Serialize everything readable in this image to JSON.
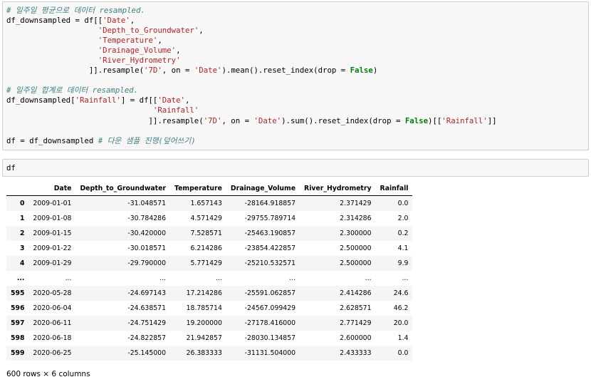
{
  "cell1": {
    "line1_comment": "# 일주일 평균으로 데이터 resampled.",
    "line2_pre": "df_downsampled = df[[",
    "line2_str": "'Date'",
    "line2_post": ",",
    "line3_indent": "                    ",
    "line3_str": "'Depth_to_Groundwater'",
    "line3_post": ",",
    "line4_indent": "                    ",
    "line4_str": "'Temperature'",
    "line4_post": ",",
    "line5_indent": "                    ",
    "line5_str": "'Drainage_Volume'",
    "line5_post": ",",
    "line6_indent": "                    ",
    "line6_str": "'River_Hydrometry'",
    "line7_pre": "                  ]].resample(",
    "line7_str1": "'7D'",
    "line7_mid1": ", on = ",
    "line7_str2": "'Date'",
    "line7_mid2": ").mean().reset_index(drop = ",
    "line7_kw": "False",
    "line7_post": ")",
    "line9_comment": "# 일주일 합계로 데이터 resampled.",
    "line10_pre": "df_downsampled[",
    "line10_str1": "'Rainfall'",
    "line10_mid": "] = df[[",
    "line10_str2": "'Date'",
    "line10_post": ",",
    "line11_indent": "                                ",
    "line11_str": "'Rainfall'",
    "line12_pre": "                               ]].resample(",
    "line12_str1": "'7D'",
    "line12_mid1": ", on = ",
    "line12_str2": "'Date'",
    "line12_mid2": ").sum().reset_index(drop = ",
    "line12_kw": "False",
    "line12_mid3": ")[[",
    "line12_str3": "'Rainfall'",
    "line12_post": "]]",
    "line14_code": "df = df_downsampled ",
    "line14_comment": "# 다운 샘플 진행(덮어쓰기)"
  },
  "cell2": {
    "code": "df"
  },
  "table": {
    "columns": [
      "",
      "Date",
      "Depth_to_Groundwater",
      "Temperature",
      "Drainage_Volume",
      "River_Hydrometry",
      "Rainfall"
    ],
    "rows": [
      [
        "0",
        "2009-01-01",
        "-31.048571",
        "1.657143",
        "-28164.918857",
        "2.371429",
        "0.0"
      ],
      [
        "1",
        "2009-01-08",
        "-30.784286",
        "4.571429",
        "-29755.789714",
        "2.314286",
        "2.0"
      ],
      [
        "2",
        "2009-01-15",
        "-30.420000",
        "7.528571",
        "-25463.190857",
        "2.300000",
        "0.2"
      ],
      [
        "3",
        "2009-01-22",
        "-30.018571",
        "6.214286",
        "-23854.422857",
        "2.500000",
        "4.1"
      ],
      [
        "4",
        "2009-01-29",
        "-29.790000",
        "5.771429",
        "-25210.532571",
        "2.500000",
        "9.9"
      ],
      [
        "...",
        "...",
        "...",
        "...",
        "...",
        "...",
        "..."
      ],
      [
        "595",
        "2020-05-28",
        "-24.697143",
        "17.214286",
        "-25591.062857",
        "2.414286",
        "24.6"
      ],
      [
        "596",
        "2020-06-04",
        "-24.638571",
        "18.785714",
        "-24567.099429",
        "2.628571",
        "46.2"
      ],
      [
        "597",
        "2020-06-11",
        "-24.751429",
        "19.200000",
        "-27178.416000",
        "2.771429",
        "20.0"
      ],
      [
        "598",
        "2020-06-18",
        "-24.822857",
        "21.942857",
        "-28030.134857",
        "2.600000",
        "1.4"
      ],
      [
        "599",
        "2020-06-25",
        "-25.145000",
        "26.383333",
        "-31131.504000",
        "2.433333",
        "0.0"
      ]
    ]
  },
  "footer": "600 rows × 6 columns"
}
